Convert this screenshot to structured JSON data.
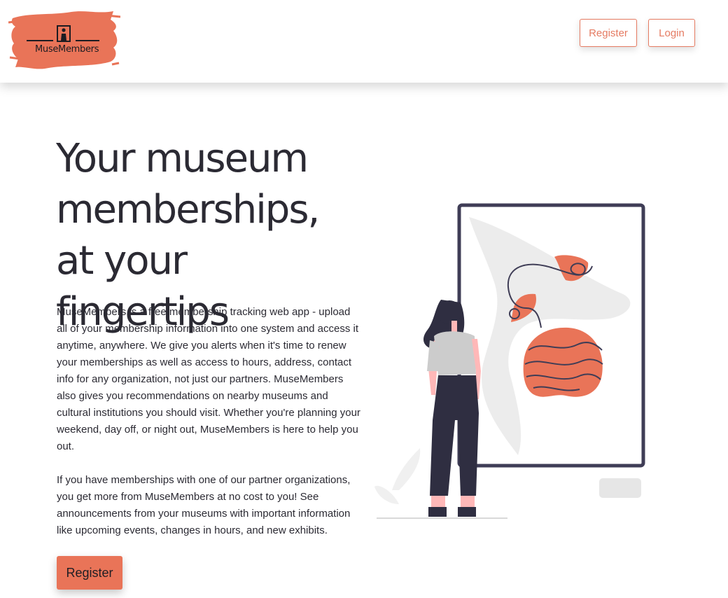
{
  "brand": {
    "name": "MuseMembers",
    "accent_color": "#E97458",
    "dark_color": "#2B2A33"
  },
  "nav": {
    "register_label": "Register",
    "login_label": "Login"
  },
  "hero": {
    "title": "Your museum memberships, at your fingertips",
    "paragraph_1": "MuseMembers is a free membership tracking web app - upload all of your membership information into one system and access it anytime, anywhere. We give you alerts when it's time to renew your memberships as well as access to hours, address, contact info for any organization, not just our partners. MuseMembers also gives you recommendations on nearby museums and cultural institutions you should visit. Whether you're planning your weekend, day off, or night out, MuseMembers is here to help you out.",
    "paragraph_2": "If you have memberships with one of our partner organizations, you get more from MuseMembers at no cost to you! See announcements from your museums with important information like upcoming events, changes in hours, and new exhibits.",
    "cta_label": "Register"
  },
  "icons": {
    "logo": "museum-visitor-logo",
    "illustration": "woman-viewing-art-illustration"
  }
}
